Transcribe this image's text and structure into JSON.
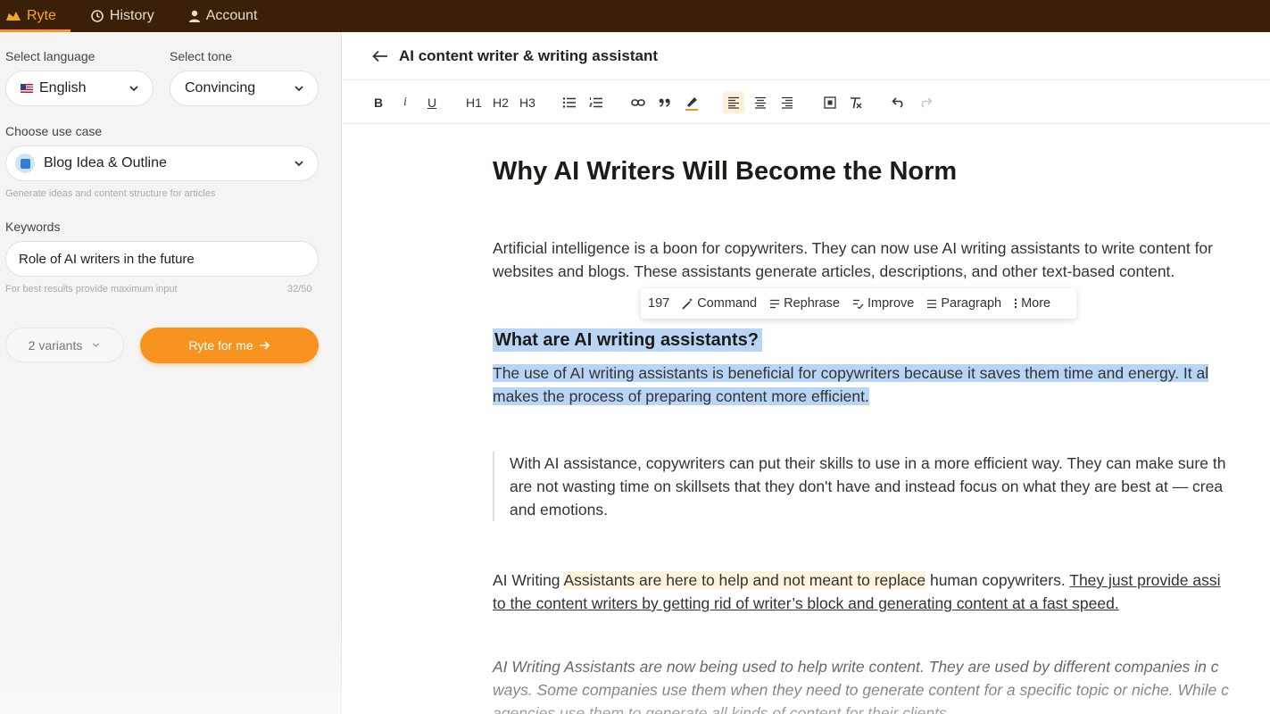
{
  "topnav": {
    "brand": "Ryte",
    "history": "History",
    "account": "Account"
  },
  "left": {
    "language_label": "Select language",
    "language_value": "English",
    "tone_label": "Select tone",
    "tone_value": "Convincing",
    "usecase_label": "Choose use case",
    "usecase_value": "Blog Idea & Outline",
    "usecase_hint": "Generate ideas and content structure for articles",
    "keywords_label": "Keywords",
    "keywords_value": "Role of AI writers in the future",
    "keywords_hint": "For best results provide maximum input",
    "keywords_count": "32/50",
    "variants": "2 variants",
    "ryte_button": "Ryte for me"
  },
  "editor": {
    "title": "AI content writer & writing assistant",
    "toolbar": {
      "bold": "B",
      "italic": "i",
      "underline": "U",
      "h1": "H1",
      "h2": "H2",
      "h3": "H3"
    },
    "floating": {
      "count": "197",
      "command": "Command",
      "rephrase": "Rephrase",
      "improve": "Improve",
      "paragraph": "Paragraph",
      "more": "More"
    },
    "doc": {
      "heading": "Why AI Writers Will Become the Norm",
      "p1_line1": "Artificial intelligence is a boon for copywriters. They can now use AI writing assistants to write content for",
      "p1_line2": "websites and blogs. These assistants generate articles, descriptions, and other text-based content.",
      "subheading": "What are AI writing assistants?",
      "p2_line1": "The use of AI writing assistants is beneficial for copywriters because it saves them time and energy. It al",
      "p2_line2": "makes the process of preparing content more efficient.",
      "q_line1": "With AI assistance, copywriters can put their skills to use in a more efficient way. They can make sure th",
      "q_line2": "are not wasting time on skillsets that they don't have and instead focus on what they are best at — crea",
      "q_line3": "and emotions.",
      "p3_a": "AI Writing ",
      "p3_b": "Assistants are here to help and not meant to replace",
      "p3_c": " human copywriters. ",
      "p3_d": "They just provide assi",
      "p3_line2": "to the content writers by getting rid of writer’s block and generating content at a fast speed.",
      "p4_line1": "AI Writing Assistants are now being used to help write content. They are used by different companies in c",
      "p4_line2": "ways. Some companies use them when they need to generate content for a specific topic or niche. While c",
      "p4_line3": "agencies use them to generate all kinds of content for their clients."
    }
  },
  "colors": {
    "nav_bg": "#3a1f09",
    "accent": "#f7931e",
    "selection": "#b9d5f5",
    "highlight": "#fdf2dc"
  }
}
